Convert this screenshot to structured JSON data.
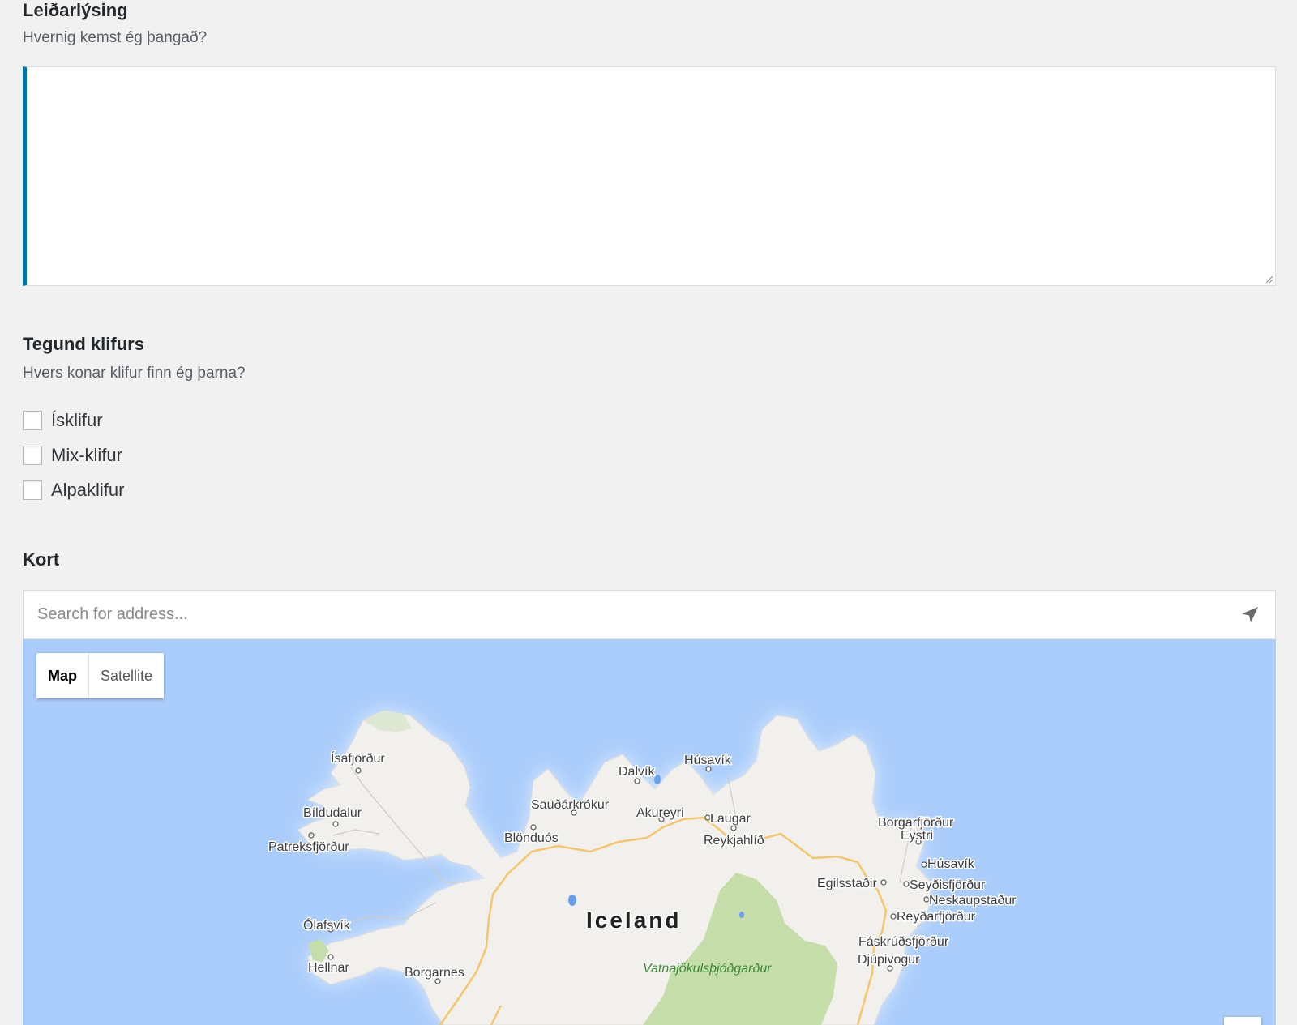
{
  "directions": {
    "label": "Leiðarlýsing",
    "description": "Hvernig kemst ég þangað?",
    "value": ""
  },
  "climb_type": {
    "label": "Tegund klifurs",
    "description": "Hvers konar klifur finn ég þarna?",
    "options": [
      {
        "label": "Ísklifur",
        "checked": false
      },
      {
        "label": "Mix-klifur",
        "checked": false
      },
      {
        "label": "Alpaklifur",
        "checked": false
      }
    ]
  },
  "map_field": {
    "label": "Kort",
    "search": {
      "placeholder": "Search for address...",
      "value": "",
      "locate_icon": "navigation-arrow-icon"
    },
    "map_type": {
      "options": [
        "Map",
        "Satellite"
      ],
      "selected": "Map"
    },
    "country_label": "Iceland",
    "park_label": "Vatnajökulsþjóðgarður",
    "places": [
      "Ísafjörður",
      "Bíldudalur",
      "Patreksfjörður",
      "Ólafsvík",
      "Hellnar",
      "Borgarnes",
      "Blönduós",
      "Sauðárkrókur",
      "Dalvík",
      "Akureyri",
      "Húsavík",
      "Laugar",
      "Reykjahlíð",
      "Borgarfjörður",
      "Eystri",
      "Húsavík",
      "Egilsstaðir",
      "Seyðisfjörður",
      "Neskaupstaður",
      "Reyðarfjörður",
      "Fáskrúðsfjörður",
      "Djúpivogur"
    ],
    "colors": {
      "water": "#abcdfb",
      "land": "#f2f0ec",
      "park": "#c5dea9",
      "road": "#f5c66b"
    }
  },
  "colors": {
    "page_bg": "#f1f1f1",
    "focus_accent": "#0073aa"
  }
}
